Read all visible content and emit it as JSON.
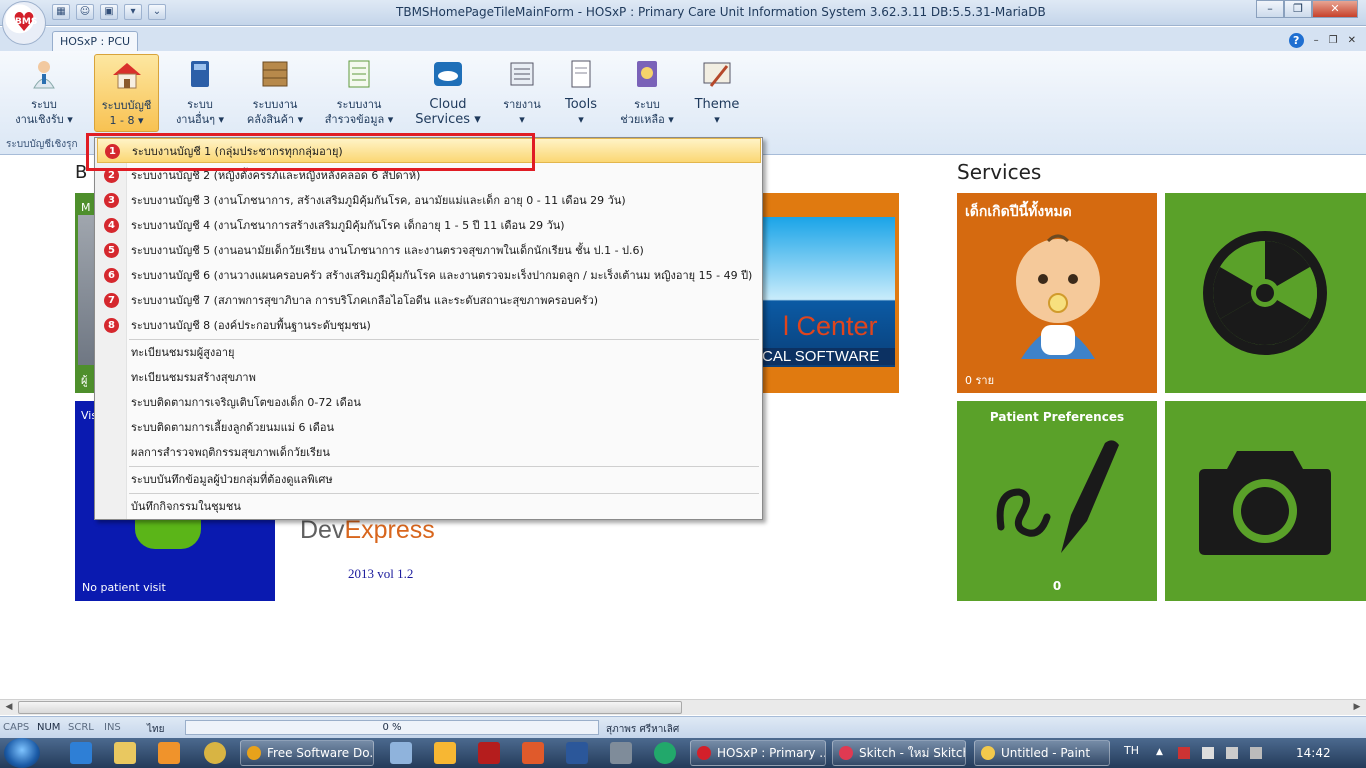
{
  "window": {
    "title": "TBMSHomePageTileMainForm -  HOSxP : Primary Care Unit Information System 3.62.3.11 DB:5.5.31-MariaDB",
    "logo_text": "BMS",
    "minimize": "–",
    "maximize": "❐",
    "close": "✕"
  },
  "ribbon": {
    "tab": "HOSxP : PCU",
    "help": "?",
    "mini_min": "–",
    "mini_max": "❐",
    "mini_close": "✕",
    "group_caption": "ระบบบัญชีเชิงรุก",
    "buttons": [
      {
        "line1": "ระบบ",
        "line2": "งานเชิงรับ ▾",
        "icon": "doctor-icon"
      },
      {
        "line1": "ระบบบัญชี",
        "line2": "1 - 8 ▾",
        "icon": "home-icon"
      },
      {
        "line1": "ระบบ",
        "line2": "งานอื่นๆ ▾",
        "icon": "book-icon"
      },
      {
        "line1": "ระบบงาน",
        "line2": "คลังสินค้า ▾",
        "icon": "boxes-icon"
      },
      {
        "line1": "ระบบงาน",
        "line2": "สำรวจข้อมูล ▾",
        "icon": "spreadsheet-icon"
      },
      {
        "line1": "Cloud",
        "line2": "Services ▾",
        "icon": "cloud-icon"
      },
      {
        "line1": "รายงาน",
        "line2": "▾",
        "icon": "report-icon"
      },
      {
        "line1": "Tools",
        "line2": "▾",
        "icon": "tools-icon"
      },
      {
        "line1": "ระบบ",
        "line2": "ช่วยเหลือ ▾",
        "icon": "help-book-icon"
      },
      {
        "line1": "Theme",
        "line2": "▾",
        "icon": "theme-icon"
      }
    ]
  },
  "dropdown": {
    "items": [
      {
        "num": "1",
        "label": "ระบบงานบัญชี 1 (กลุ่มประชากรทุกกลุ่มอายุ)"
      },
      {
        "num": "2",
        "label": "ระบบงานบัญชี 2 (หญิงตั้งครรภ์และหญิงหลังคลอด 6 สัปดาห์)"
      },
      {
        "num": "3",
        "label": "ระบบงานบัญชี 3 (งานโภชนาการ, สร้างเสริมภูมิคุ้มกันโรค, อนามัยแม่และเด็ก อายุ 0 - 11 เดือน 29 วัน)"
      },
      {
        "num": "4",
        "label": "ระบบงานบัญชี 4 (งานโภชนาการสร้างเสริมภูมิคุ้มกันโรค เด็กอายุ 1 - 5 ปี 11 เดือน 29 วัน)"
      },
      {
        "num": "5",
        "label": "ระบบงานบัญชี 5 (งานอนามัยเด็กวัยเรียน งานโภชนาการ และงานตรวจสุขภาพในเด็กนักเรียน ชั้น ป.1 - ป.6)"
      },
      {
        "num": "6",
        "label": "ระบบงานบัญชี 6 (งานวางแผนครอบครัว สร้างเสริมภูมิคุ้มกันโรค และงานตรวจมะเร็งปากมดลูก / มะเร็งเต้านม หญิงอายุ 15 - 49 ปี)"
      },
      {
        "num": "7",
        "label": "ระบบงานบัญชี 7 (สภาพการสุขาภิบาล การบริโภคเกลือไอโอดีน และระดับสถานะสุขภาพครอบครัว)"
      },
      {
        "num": "8",
        "label": "ระบบงานบัญชี 8 (องค์ประกอบพื้นฐานระดับชุมชน)"
      }
    ],
    "extra_items": [
      "ทะเบียนชมรมผู้สูงอายุ",
      "ทะเบียนชมรมสร้างสุขภาพ",
      "ระบบติดตามการเจริญเติบโตของเด็ก 0-72 เดือน",
      "ระบบติดตามการเลี้ยงลูกด้วยนมแม่ 6 เดือน",
      "ผลการสำรวจพฤติกรรมสุขภาพเด็กวัยเรียน"
    ],
    "special_item": "ระบบบันทึกข้อมูลผู้ป่วยกลุ่มที่ต้องดูแลพิเศษ",
    "community_item": "บันทึกกิจกรรมในชุมชน"
  },
  "main": {
    "left_heading": "B",
    "services_heading": "Services",
    "tiles": {
      "my_title": "M",
      "my_footer": "ผู้",
      "visit_title": "Vis",
      "visit_footer": "No patient visit",
      "center_text": "l Center",
      "center_sub": "CAL SOFTWARE",
      "devexpress_a": "Dev",
      "devexpress_b": "Express",
      "devexpress_version": "2013 vol 1.2",
      "newborn_title": "เด็กเกิดปีนี้ทั้งหมด",
      "newborn_count": "0 ราย",
      "pref_title": "Patient Preferences",
      "pref_count": "0"
    }
  },
  "statusbar": {
    "caps": "CAPS",
    "num": "NUM",
    "scrl": "SCRL",
    "ins": "INS",
    "lang": "ไทย",
    "progress": "0 %",
    "user": "สุภาพร ศรีหาเลิศ"
  },
  "taskbar": {
    "tasks": [
      {
        "label": "Free Software Do...",
        "color": "#e8a21b"
      },
      {
        "label": "HOSxP : Primary ...",
        "color": "#d3202a"
      },
      {
        "label": "Skitch - ใหม่ Skitch",
        "color": "#e03a52"
      },
      {
        "label": "Untitled - Paint",
        "color": "#f2c94c"
      }
    ],
    "lang": "TH",
    "clock": "14:42"
  },
  "colors": {
    "accent_red": "#e01c24",
    "tile_orange": "#d56a10",
    "tile_green": "#5aa129",
    "tile_blue": "#0a1ab0"
  }
}
